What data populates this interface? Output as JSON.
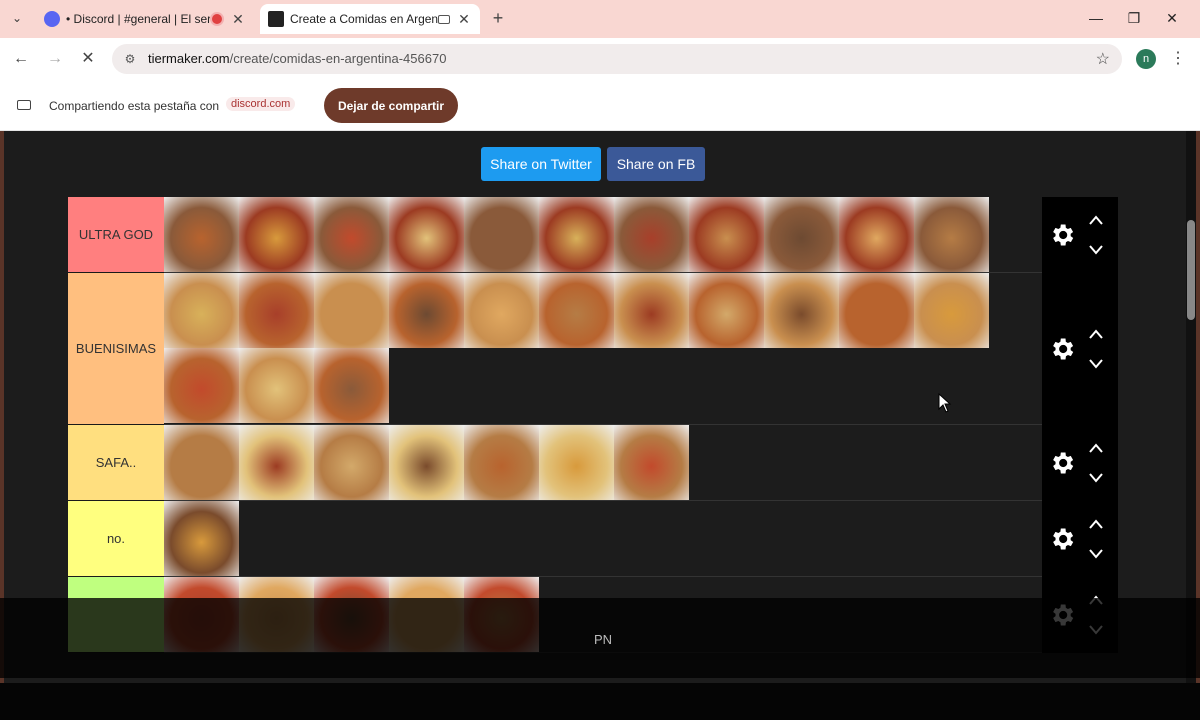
{
  "browser": {
    "tabs": [
      {
        "title": "• Discord | #general | El ser",
        "active": false
      },
      {
        "title": "Create a Comidas en Argen",
        "active": true
      }
    ],
    "url_domain": "tiermaker.com",
    "url_path": "/create/comidas-en-argentina-456670",
    "profile_initial": "n"
  },
  "sharing": {
    "message": "Compartiendo esta pestaña con",
    "target": "discord.com",
    "stop_label": "Dejar de compartir"
  },
  "page": {
    "share_twitter": "Share on Twitter",
    "share_fb": "Share on FB",
    "overlay_text": "PN"
  },
  "tiers": [
    {
      "label": "ULTRA GOD",
      "color": "#ff7f7f",
      "item_count": 11
    },
    {
      "label": "BUENISIMAS",
      "color": "#ffbf7f",
      "item_count": 14
    },
    {
      "label": "SAFA..",
      "color": "#ffdf7f",
      "item_count": 7
    },
    {
      "label": "no.",
      "color": "#ffff7f",
      "item_count": 1
    },
    {
      "label": "",
      "color": "#bfff7f",
      "item_count": 5
    }
  ],
  "colors": {
    "tab_strip": "#f9d7d2",
    "stop_share_button": "#6e3a2a",
    "twitter": "#1d9bf0",
    "facebook": "#3b5998",
    "page_bg": "#1c1c1c"
  }
}
